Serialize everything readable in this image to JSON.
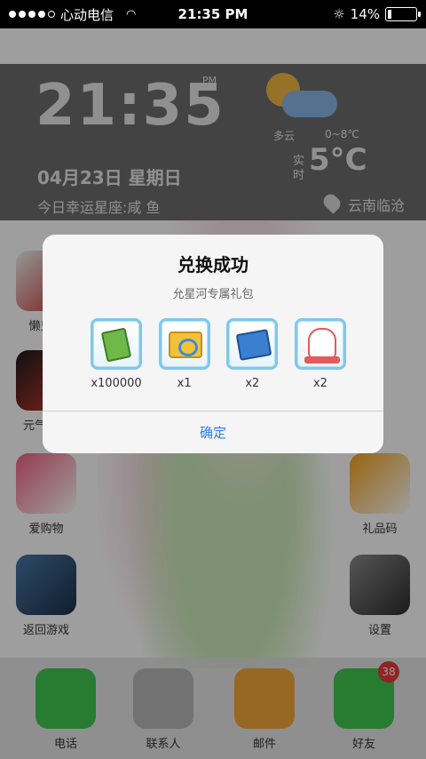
{
  "statusbar": {
    "carrier": "心动电信",
    "time": "21:35 PM",
    "battery_text": "14%",
    "battery_level": 0.14
  },
  "widget": {
    "clock": "21:35",
    "am_pm": "PM",
    "weather_condition": "多云",
    "temp_range": "0~8℃",
    "realtime_label": "实时",
    "temperature": "5°C",
    "date": "04月23日  星期日",
    "lucky_sign": "今日幸运星座:咸 鱼",
    "location": "云南临沧"
  },
  "apps": [
    {
      "label": "懒鬼日",
      "color": "#f4f4f4",
      "accent": "#c02a2a"
    },
    {
      "label": "元气股市",
      "color": "#1b1b1b",
      "accent": "#d83a2a"
    },
    {
      "label": "爱购物",
      "color": "#f06080",
      "accent": "#ffffff"
    },
    {
      "label": "返回游戏",
      "color": "#4a78a8",
      "accent": "#1e2f4a"
    },
    {
      "label": "礼品码",
      "color": "#f4a21a",
      "accent": "#ffffff"
    },
    {
      "label": "设置",
      "color": "#8a8a8a",
      "accent": "#2d2d2d"
    }
  ],
  "dock": [
    {
      "label": "电话",
      "color": "#3fc950"
    },
    {
      "label": "联系人",
      "color": "#b8b8b8"
    },
    {
      "label": "邮件",
      "color": "#f2a93a"
    },
    {
      "label": "好友",
      "color": "#3fc950",
      "badge": "38"
    }
  ],
  "dialog": {
    "title": "兑换成功",
    "subtitle": "允星河专属礼包",
    "rewards": [
      {
        "icon": "cash-icon",
        "qty": "x100000"
      },
      {
        "icon": "ticket-icon",
        "qty": "x1"
      },
      {
        "icon": "book-icon",
        "qty": "x2"
      },
      {
        "icon": "lucky-cat-icon",
        "qty": "x2"
      }
    ],
    "confirm_label": "确定"
  }
}
